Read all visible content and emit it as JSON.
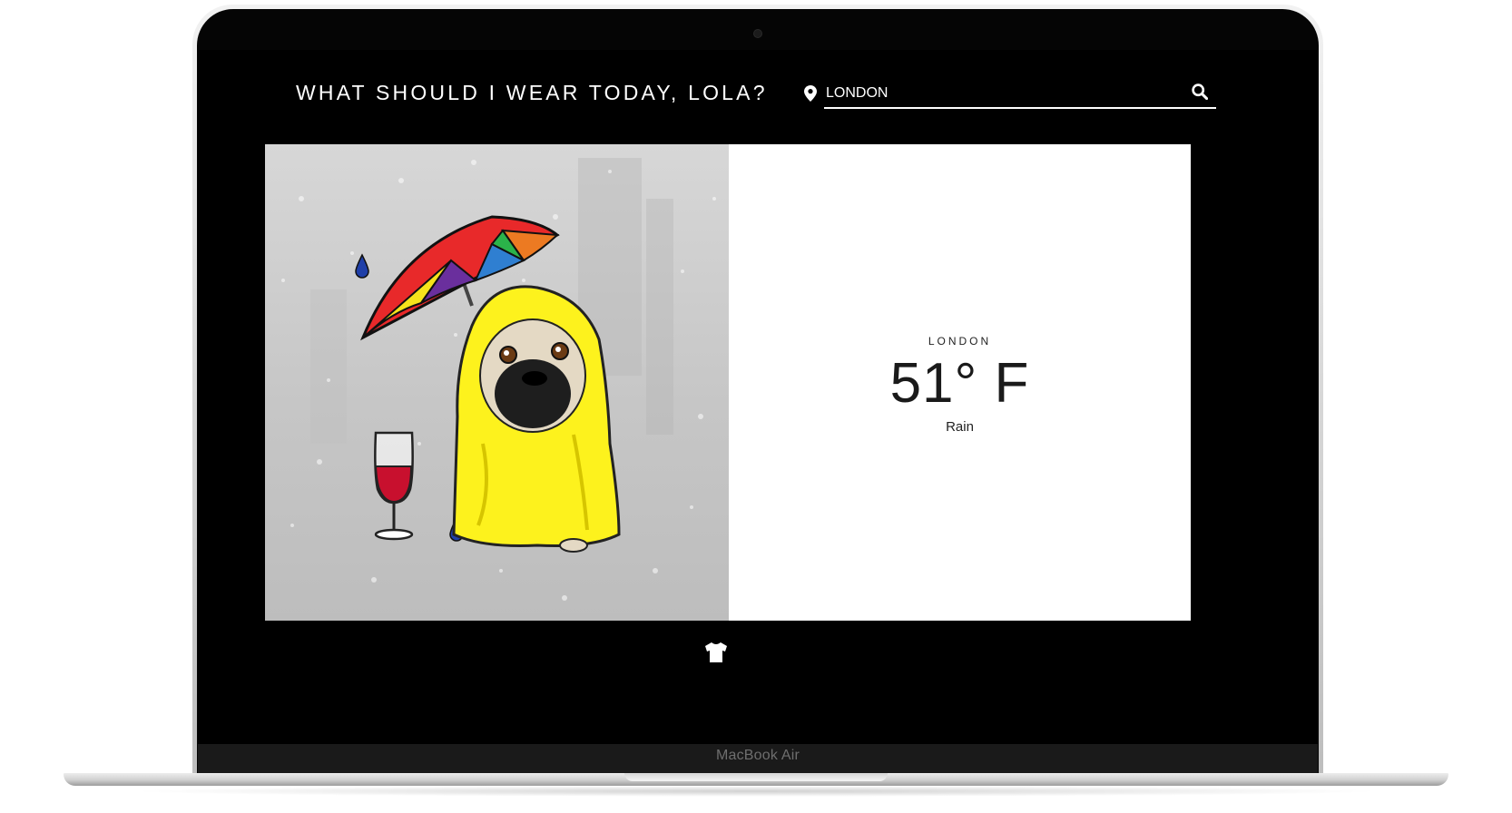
{
  "device": {
    "model_label": "MacBook Air"
  },
  "header": {
    "title": "WHAT SHOULD I WEAR TODAY, LOLA?",
    "location_icon": "map-pin-icon",
    "search_value": "LONDON",
    "search_icon": "search-icon"
  },
  "illustration": {
    "description_icons": [
      "umbrella",
      "pug-in-raincoat",
      "wine-glass",
      "raindrop"
    ]
  },
  "weather": {
    "city": "LONDON",
    "temperature": "51° F",
    "condition": "Rain"
  },
  "footer": {
    "outfit_icon": "tshirt-icon"
  },
  "colors": {
    "screen_bg": "#000000",
    "text_on_dark": "#ffffff",
    "raincoat": "#fdf21d",
    "wine": "#c8102e",
    "drop": "#1f3fa8"
  }
}
